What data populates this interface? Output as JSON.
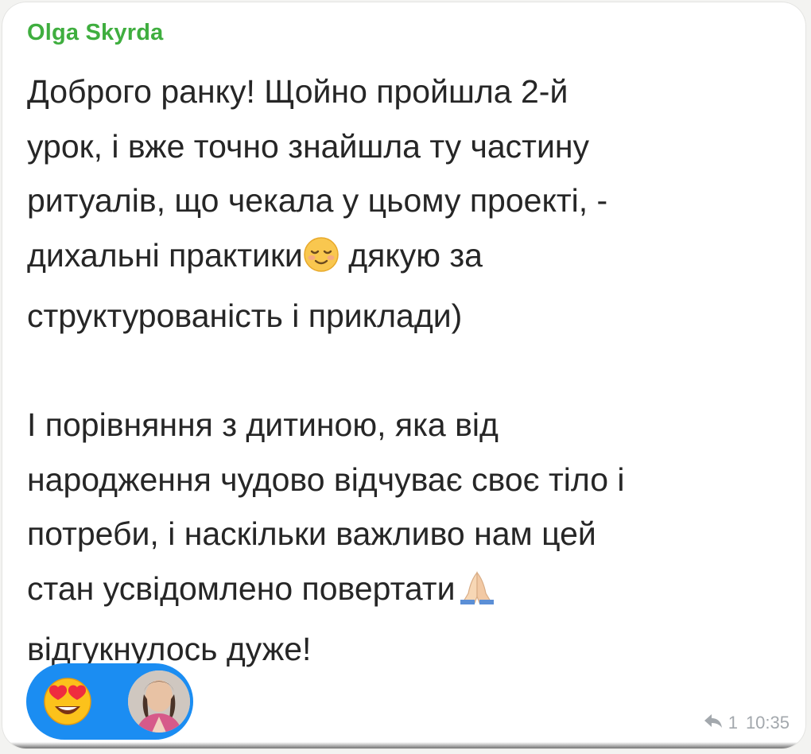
{
  "message": {
    "sender": "Olga Skyrda",
    "lines": [
      "Доброго ранку! Щойно пройшла 2-й",
      "урок, і вже точно знайшла ту частину",
      "ритуалів, що чекала у цьому проекті, -",
      "дихальні практики",
      " дякую за",
      "структурованість і приклади)",
      "І порівняння з дитиною, яка від",
      "народження чудово відчуває своє тіло і",
      "потреби, і наскільки важливо нам цей",
      "стан усвідомлено повертати",
      "відгукнулось дуже!"
    ],
    "inline_emojis": [
      "smiling-face-with-closed-eyes",
      "folded-hands"
    ]
  },
  "reactions": {
    "emoji": "smiling-face-with-heart-eyes",
    "reactor_avatar": "avatar"
  },
  "meta": {
    "reply_icon": "reply-arrow-icon",
    "reply_count": "1",
    "time": "10:35"
  },
  "colors": {
    "sender_name": "#3fae3f",
    "reaction_pill": "#1b8df2",
    "message_text": "#262626",
    "meta_text": "#a3a8ad"
  }
}
